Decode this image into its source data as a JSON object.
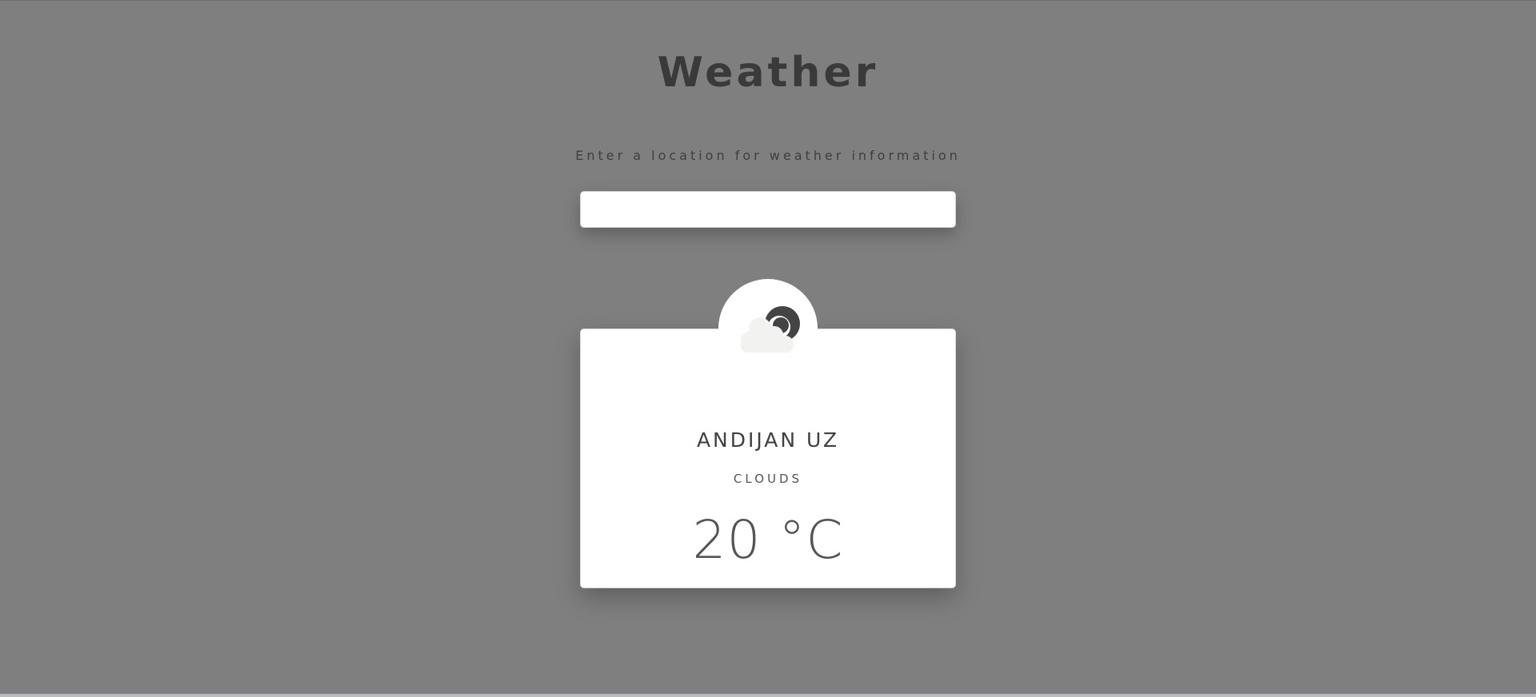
{
  "header": {
    "title": "Weather",
    "prompt": "Enter a location for weather information"
  },
  "search": {
    "value": "",
    "placeholder": ""
  },
  "weather_card": {
    "icon": "moon-cloud-icon",
    "city": "ANDIJAN UZ",
    "condition": "CLOUDS",
    "temperature": "20 °C"
  },
  "colors": {
    "background": "#7f7f7f",
    "card": "#ffffff",
    "text_dark": "#3a3a3a",
    "icon_moon": "#444444",
    "icon_cloud": "#f2f2f0"
  }
}
